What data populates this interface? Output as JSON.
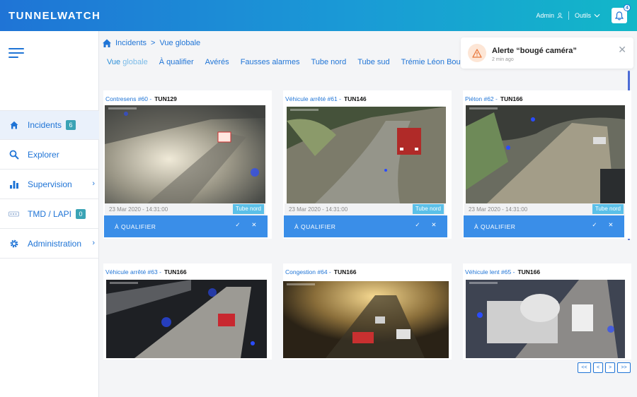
{
  "header": {
    "brand": "TUNNELWATCH",
    "user_label": "Admin",
    "tools_label": "Outils",
    "notification_count": "4"
  },
  "sidebar": {
    "items": [
      {
        "label": "Incidents",
        "badge": "6",
        "icon": "home-icon",
        "active": true
      },
      {
        "label": "Explorer",
        "icon": "search-icon"
      },
      {
        "label": "Supervision",
        "icon": "bar-chart-icon",
        "chevron": "›"
      },
      {
        "label": "TMD / LAPI",
        "badge": "0",
        "icon": "plate-icon"
      },
      {
        "label": "Administration",
        "icon": "gear-icon",
        "chevron": "›"
      }
    ]
  },
  "breadcrumb": {
    "root": "Incidents",
    "separator": ">",
    "current": "Vue globale"
  },
  "tabs": [
    {
      "label_a": "Vue ",
      "label_b": "globale",
      "active": true
    },
    {
      "label": "À qualifier"
    },
    {
      "label": "Avérés"
    },
    {
      "label": "Fausses alarmes"
    },
    {
      "label": "Tube nord"
    },
    {
      "label": "Tube sud"
    },
    {
      "label": "Trémie Léon Bourgeois"
    }
  ],
  "alert": {
    "title": "Alerte “bougé caméra”",
    "time": "2 min ago",
    "close": "✕"
  },
  "cards": [
    {
      "type": "Contresens #60",
      "sep": "-",
      "tunnel": "TUN129",
      "date": "23 Mar 2020 - 14:31:00",
      "tag": "Tube nord",
      "action": "À QUALIFIER",
      "ok": "✓",
      "no": "✕"
    },
    {
      "type": "Véhicule arrêté #61",
      "sep": "-",
      "tunnel": "TUN146",
      "date": "23 Mar 2020 - 14:31:00",
      "tag": "Tube nord",
      "action": "À QUALIFIER",
      "ok": "✓",
      "no": "✕"
    },
    {
      "type": "Piéton #62",
      "sep": "-",
      "tunnel": "TUN166",
      "date": "23 Mar 2020 - 14:31:00",
      "tag": "Tube nord",
      "action": "À QUALIFIER",
      "ok": "✓",
      "no": "✕"
    },
    {
      "type": "Véhicule arrêté #63",
      "sep": "-",
      "tunnel": "TUN166"
    },
    {
      "type": "Congestion #64",
      "sep": "-",
      "tunnel": "TUN166"
    },
    {
      "type": "Véhicule lent #65",
      "sep": "-",
      "tunnel": "TUN166"
    }
  ],
  "pagination": {
    "first": "<<",
    "prev": "<",
    "next": ">",
    "last": ">>"
  },
  "colors": {
    "accent": "#1f74d6",
    "action": "#3a8ee8",
    "tag": "#5bc0e8",
    "badge": "#3aa3b5"
  }
}
